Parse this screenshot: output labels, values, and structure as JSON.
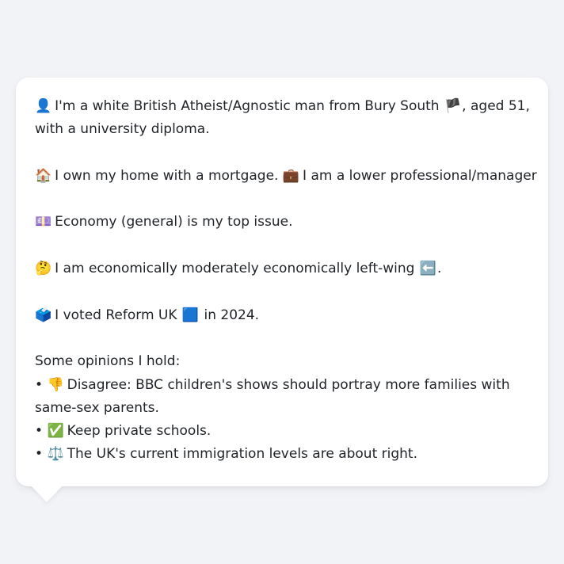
{
  "profile": {
    "identity": {
      "icon": "👤",
      "line1": "I'm a white British Atheist/Agnostic man from Bury South",
      "flag": "🏴",
      "line1_end": ", aged 51,",
      "line2": "with a university diploma."
    },
    "home": {
      "icon": "🏠",
      "text": "I own my home with a mortgage.",
      "job_icon": "💼",
      "job_text": "I am a lower professional/manager"
    },
    "issue": {
      "icon": "💷",
      "text": "Economy (general) is my top issue."
    },
    "economics": {
      "icon": "🤔",
      "text": "I am economically moderately economically left-wing",
      "arrow": "⬅️",
      "end": "."
    },
    "vote": {
      "icon": "🗳️",
      "text_a": "I voted Reform UK",
      "party_icon": "🟦",
      "text_b": "in 2024."
    },
    "opinions": {
      "heading": "Some opinions I hold:",
      "bullet": "•",
      "items": [
        {
          "icon": "👎",
          "text": "Disagree: BBC children's shows should portray more families with",
          "cont": "same-sex parents."
        },
        {
          "icon": "✅",
          "text": "Keep private schools."
        },
        {
          "icon": "⚖️",
          "text": "The UK's current immigration levels are about right."
        }
      ]
    }
  }
}
